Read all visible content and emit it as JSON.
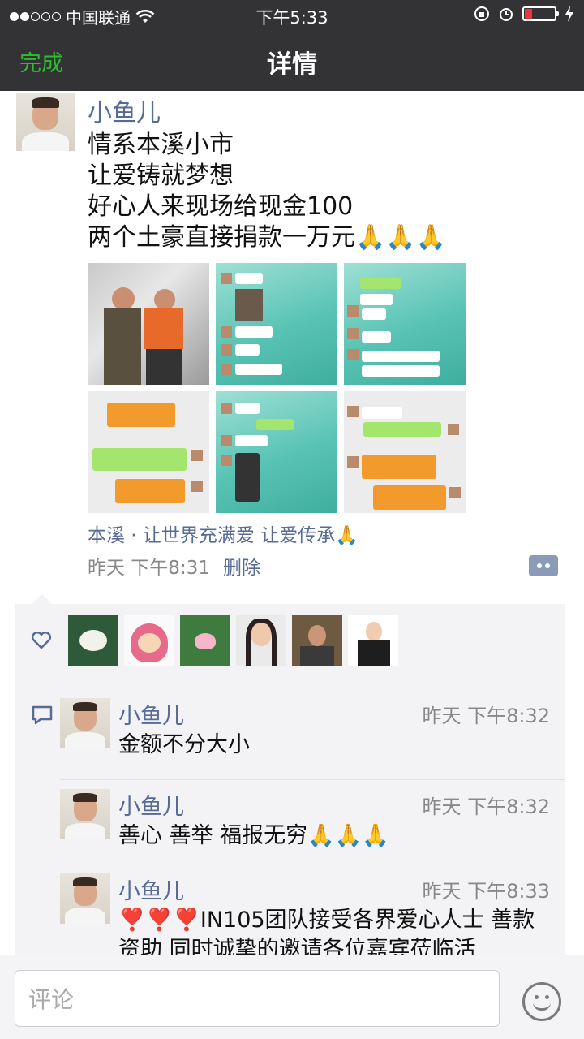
{
  "status_bar": {
    "carrier": "中国联通",
    "time": "下午5:33"
  },
  "nav": {
    "done_label": "完成",
    "title": "详情"
  },
  "post": {
    "author": "小鱼儿",
    "lines": [
      "情系本溪小市",
      "让爱铸就梦想",
      "好心人来现场给现金100",
      "两个土豪直接捐款一万元🙏🙏🙏"
    ],
    "location": "本溪 · 让世界充满爱 让爱传承🙏",
    "time": "昨天 下午8:31",
    "delete_label": "删除"
  },
  "comments": [
    {
      "name": "小鱼儿",
      "time": "昨天 下午8:32",
      "text": "金额不分大小"
    },
    {
      "name": "小鱼儿",
      "time": "昨天 下午8:32",
      "text": "善心 善举 福报无穷🙏🙏🙏"
    },
    {
      "name": "小鱼儿",
      "time": "昨天 下午8:33",
      "text": "❣️❣️❣️IN105团队接受各界爱心人士 善款资助 同时诚挚的邀请各位嘉宾莅临活"
    }
  ],
  "input": {
    "placeholder": "评论"
  },
  "icons": {
    "wifi": "wifi-icon",
    "heart": "heart-icon",
    "comment": "comment-icon",
    "emoji": "emoji-icon"
  },
  "colors": {
    "nav_bg": "#333335",
    "done_green": "#2bbf2b",
    "link_blue": "#576b95",
    "battery_red": "#e8363b"
  }
}
